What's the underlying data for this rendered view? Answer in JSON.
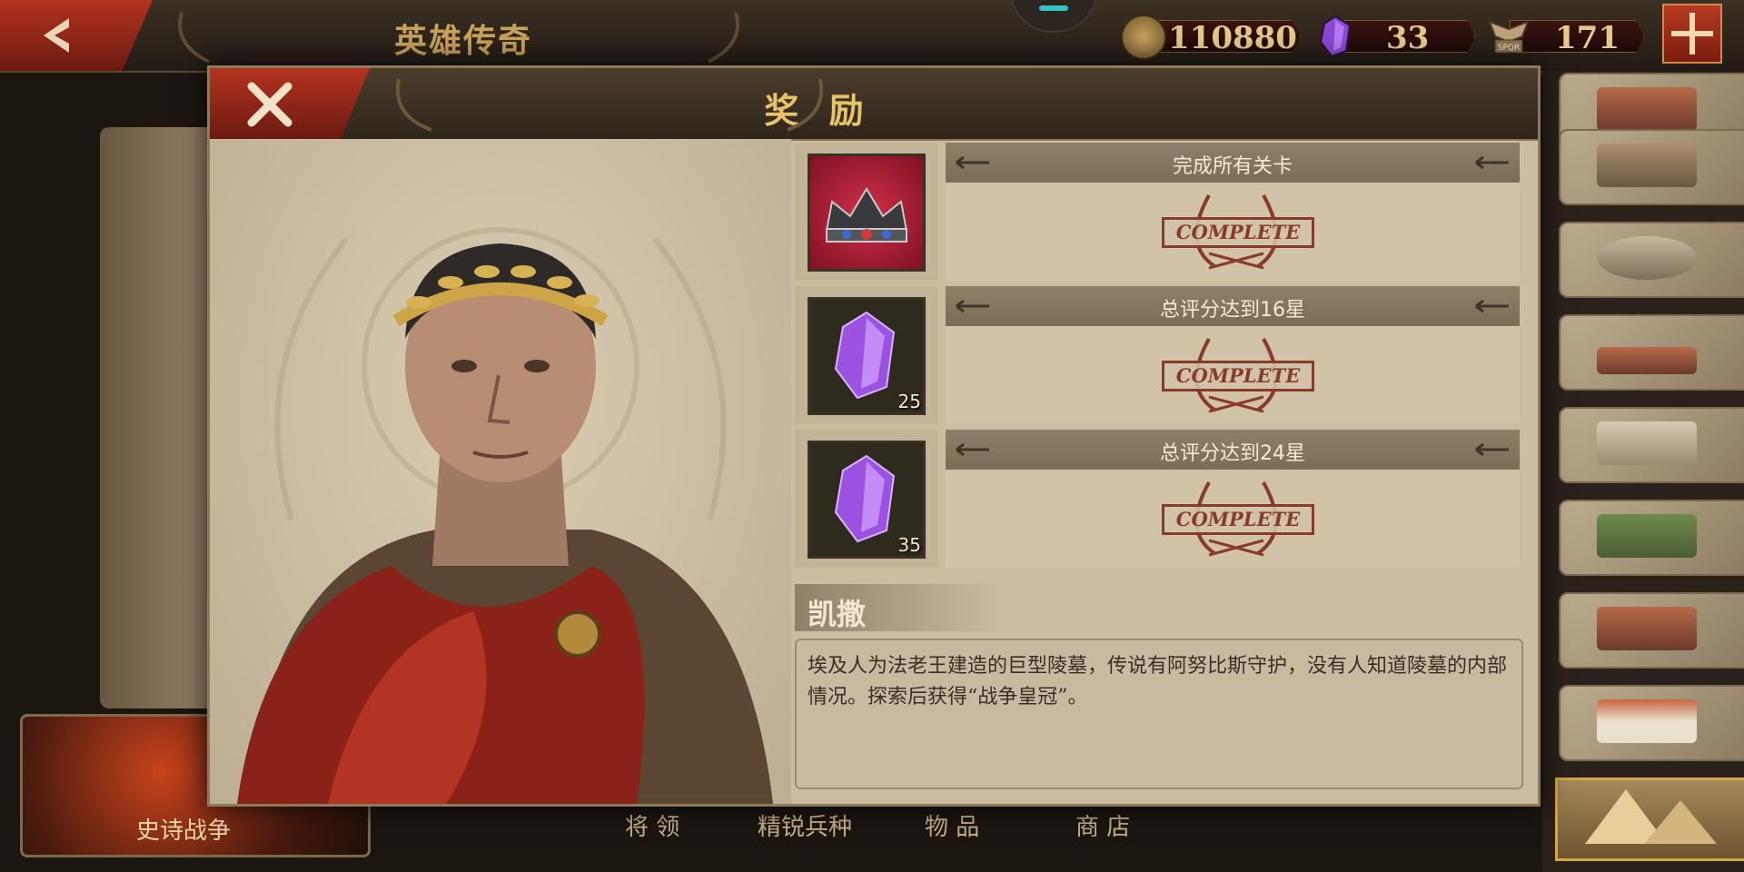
{
  "top_bar": {
    "title": "英雄传奇",
    "coins": "110880",
    "gems": "33",
    "spqr": "171",
    "spqr_badge": "SPQR"
  },
  "modal": {
    "title": "奖 励",
    "rewards": [
      {
        "condition": "完成所有关卡",
        "item": "crown-icon",
        "quantity": "",
        "status": "COMPLETE"
      },
      {
        "condition": "总评分达到16星",
        "item": "gem-icon",
        "quantity": "25",
        "status": "COMPLETE"
      },
      {
        "condition": "总评分达到24星",
        "item": "gem-icon",
        "quantity": "35",
        "status": "COMPLETE"
      }
    ],
    "hero_name": "凯撒",
    "description": "埃及人为法老王建造的巨型陵墓，传说有阿努比斯守护，没有人知道陵墓的内部情况。探索后获得“战争皇冠”。"
  },
  "bottom_nav": {
    "epic_war": "史诗战争",
    "tabs": [
      "将 领",
      "精锐兵种",
      "物 品",
      "商 店"
    ]
  },
  "colors": {
    "accent_red": "#b4331f",
    "gold": "#e7c36a",
    "panel": "#cbbda1",
    "stamp": "#8a3a2c",
    "gem_purple": "#9b52e0"
  }
}
